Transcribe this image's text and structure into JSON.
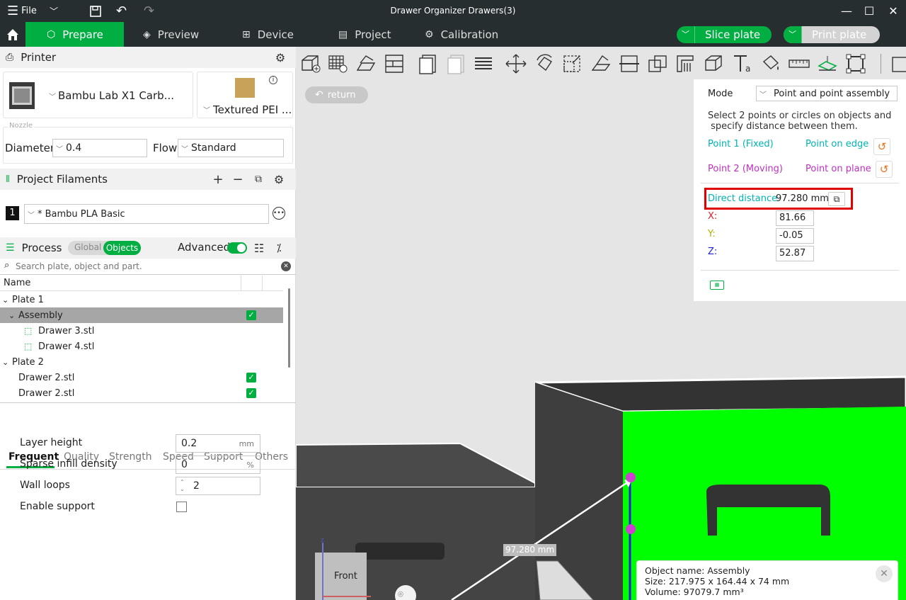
{
  "window": {
    "title": "Drawer Organizer Drawers(3)",
    "file_menu": "File"
  },
  "main_tabs": [
    {
      "label": "Prepare",
      "active": true
    },
    {
      "label": "Preview"
    },
    {
      "label": "Device"
    },
    {
      "label": "Project"
    },
    {
      "label": "Calibration"
    }
  ],
  "actions": {
    "slice": "Slice plate",
    "print": "Print plate"
  },
  "printer": {
    "section_title": "Printer",
    "model": "Bambu Lab X1 Carb...",
    "plate": "Textured PEI ...",
    "nozzle_label": "Nozzle",
    "diameter_label": "Diameter",
    "diameter_value": "0.4",
    "flow_label": "Flow",
    "flow_value": "Standard"
  },
  "filaments": {
    "section_title": "Project Filaments",
    "items": [
      {
        "index": "1",
        "name": "* Bambu PLA Basic",
        "color": "#111111"
      }
    ]
  },
  "process": {
    "section_title": "Process",
    "toggle_global": "Global",
    "toggle_objects": "Objects",
    "advanced_label": "Advanced",
    "advanced_on": true,
    "search_placeholder": "Search plate, object and part."
  },
  "object_list": {
    "header": "Name",
    "rows": [
      {
        "label": "Plate 1",
        "level": 0,
        "expand": "⌄"
      },
      {
        "label": "Assembly",
        "level": 1,
        "expand": "⌄",
        "checked": true,
        "selected": true
      },
      {
        "label": "Drawer 3.stl",
        "level": 2,
        "part": true
      },
      {
        "label": "Drawer 4.stl",
        "level": 2,
        "part": true
      },
      {
        "label": "Plate 2",
        "level": 0,
        "expand": "⌄"
      },
      {
        "label": "Drawer 2.stl",
        "level": 1,
        "checked": true
      },
      {
        "label": "Drawer 2.stl",
        "level": 1,
        "checked": true
      }
    ]
  },
  "param_tabs": [
    "Frequent",
    "Quality",
    "Strength",
    "Speed",
    "Support",
    "Others"
  ],
  "params": {
    "layer_height": {
      "label": "Layer height",
      "value": "0.2",
      "unit": "mm"
    },
    "sparse_infill": {
      "label": "Sparse infill density",
      "value": "0",
      "unit": "%"
    },
    "wall_loops": {
      "label": "Wall loops",
      "value": "2"
    },
    "enable_support": {
      "label": "Enable support",
      "checked": false
    }
  },
  "viewport": {
    "return_label": "return",
    "distance_label": "97.280 mm",
    "orientation_label": "Front"
  },
  "measure": {
    "mode_label": "Mode",
    "mode_value": "Point and point assembly",
    "instructions_1": "Select 2 points or circles on objects and",
    "instructions_2": " specify distance between them.",
    "point1_label": "Point 1 (Fixed)",
    "point1_value": "Point on edge",
    "point2_label": "Point 2 (Moving)",
    "point2_value": "Point on plane",
    "direct_distance_label": "Direct distance",
    "direct_distance_value": "97.280 mm",
    "x_label": "X:",
    "x_value": "81.66",
    "y_label": "Y:",
    "y_value": "-0.05",
    "z_label": "Z:",
    "z_value": "52.87",
    "colors": {
      "point1": "#00b4b4",
      "point2": "#c030c0",
      "x": "#e02020",
      "y": "#b0b000",
      "z": "#2020d0",
      "highlight": "#e00000"
    }
  },
  "object_info": {
    "name_line": "Object name: Assembly",
    "size_line": "Size: 217.975 x 164.44 x 74 mm",
    "volume_line": "Volume: 97079.7 mm³"
  },
  "colors": {
    "accent": "#00ae42",
    "titlebar": "#262e30",
    "panel_header": "#f1f1f1"
  }
}
